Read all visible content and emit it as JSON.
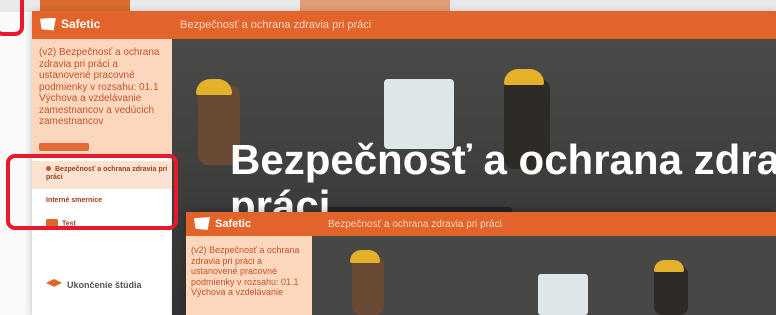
{
  "app": {
    "logo": "Safetic",
    "title": "Bezpečnosť a ochrana zdravia pri práci"
  },
  "course": {
    "title": "(v2) Bezpečnosť a ochrana zdravia pri práci a ustanovené pracovné podmienky v rozsahu: 01.1 Výchova a vzdelávanie zamestnancov a vedúcich zamestnancov",
    "title_short": "(v2) Bezpečnosť a ochrana zdravia pri práci a ustanovené pracovné podmienky v rozsahu: 01.1 Výchova a vzdelávanie"
  },
  "menu": {
    "active": "Bezpečnosť a ochrana zdravia pri práci",
    "item2": "Interné smernice",
    "item3": "Test",
    "finish": "Ukončenie štúdia"
  },
  "hero": {
    "title_line1": "Bezpečnosť a ochrana zdrav",
    "title_line2": "práci"
  },
  "colors": {
    "brand": "#e2642a",
    "highlight": "#e8192c",
    "sidebar_peach": "#fcd7bd"
  }
}
